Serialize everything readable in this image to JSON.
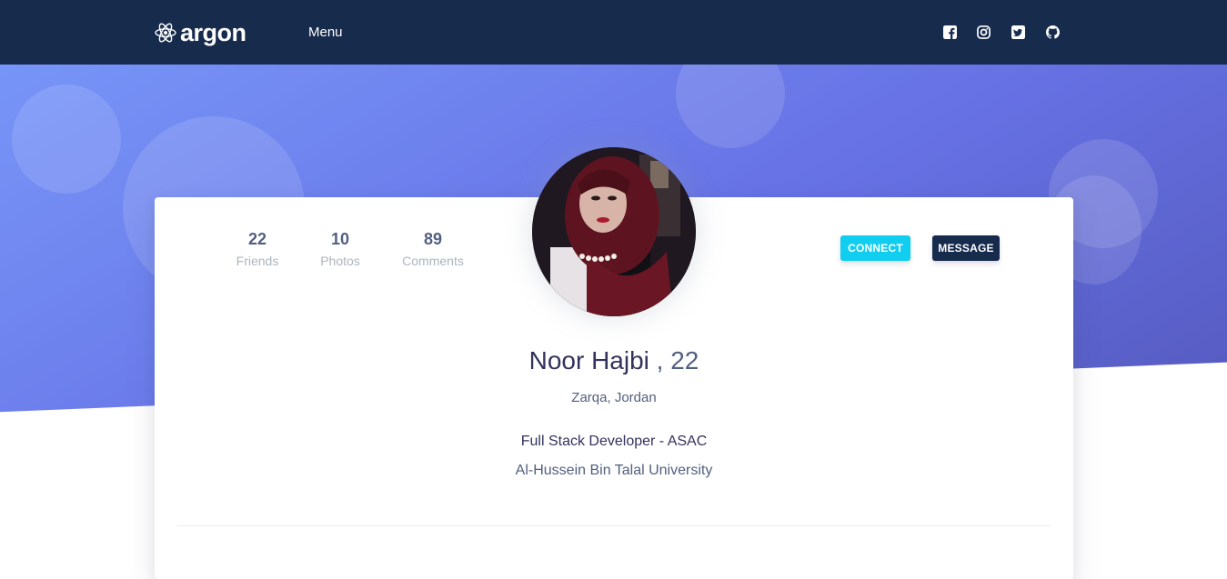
{
  "navbar": {
    "brand": "argon",
    "menu_label": "Menu",
    "social_icons": [
      "facebook-square-icon",
      "instagram-icon",
      "twitter-square-icon",
      "github-icon"
    ]
  },
  "profile": {
    "stats": [
      {
        "value": "22",
        "label": "Friends"
      },
      {
        "value": "10",
        "label": "Photos"
      },
      {
        "value": "89",
        "label": "Comments"
      }
    ],
    "buttons": {
      "connect": "Connect",
      "message": "Message"
    },
    "name": "Noor Hajbi",
    "age": ", 22",
    "location": "Zarqa, Jordan",
    "role": "Full Stack Developer - ASAC",
    "university": "Al-Hussein Bin Talal University"
  },
  "colors": {
    "navbar_bg": "#172b4d",
    "hero_gradient_start": "#7795f8",
    "hero_gradient_end": "#555abf",
    "connect_button": "#11cdef",
    "message_button": "#172b4d"
  }
}
